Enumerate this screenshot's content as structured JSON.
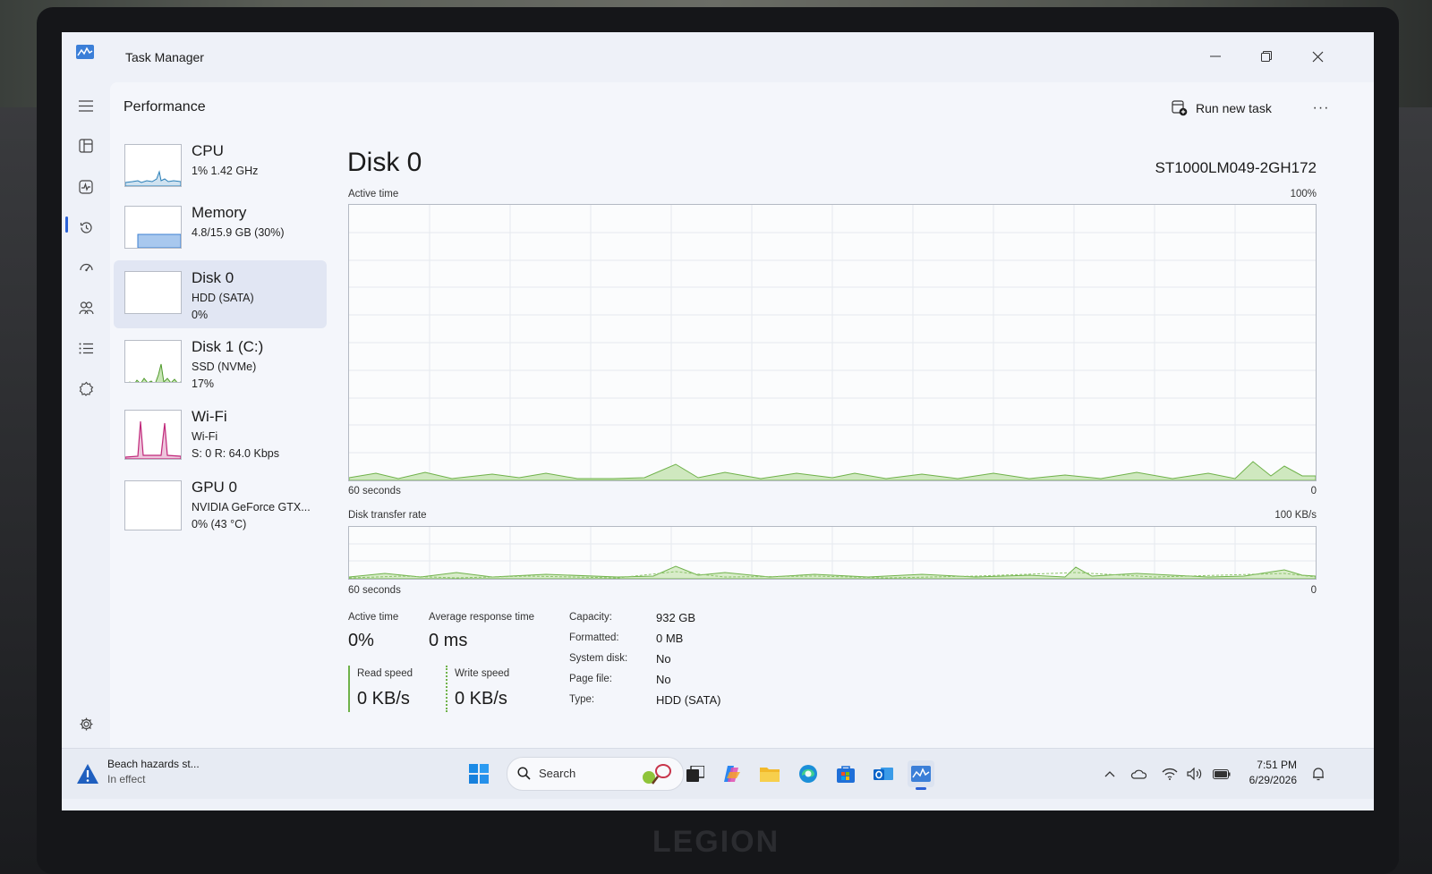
{
  "app": {
    "title": "Task Manager"
  },
  "header": {
    "title": "Performance",
    "run_new_task": "Run new task",
    "more": "···"
  },
  "devices": [
    {
      "name": "CPU",
      "sub": "1% 1.42 GHz",
      "sub2": ""
    },
    {
      "name": "Memory",
      "sub": "4.8/15.9 GB (30%)",
      "sub2": ""
    },
    {
      "name": "Disk 0",
      "sub": "HDD (SATA)",
      "sub2": "0%"
    },
    {
      "name": "Disk 1 (C:)",
      "sub": "SSD (NVMe)",
      "sub2": "17%"
    },
    {
      "name": "Wi-Fi",
      "sub": "Wi-Fi",
      "sub2": "S: 0 R: 64.0 Kbps"
    },
    {
      "name": "GPU 0",
      "sub": "NVIDIA GeForce GTX...",
      "sub2": "0% (43 °C)"
    }
  ],
  "detail": {
    "title": "Disk 0",
    "model": "ST1000LM049-2GH172",
    "active_graph": {
      "label": "Active time",
      "max": "100%",
      "time": "60 seconds",
      "min": "0"
    },
    "transfer_graph": {
      "label": "Disk transfer rate",
      "max": "100 KB/s",
      "time": "60 seconds",
      "min": "0"
    },
    "stats": {
      "active_time_label": "Active time",
      "active_time": "0%",
      "avg_response_label": "Average response time",
      "avg_response": "0 ms",
      "read_label": "Read speed",
      "read": "0 KB/s",
      "write_label": "Write speed",
      "write": "0 KB/s"
    },
    "info": [
      {
        "key": "Capacity:",
        "value": "932 GB"
      },
      {
        "key": "Formatted:",
        "value": "0 MB"
      },
      {
        "key": "System disk:",
        "value": "No"
      },
      {
        "key": "Page file:",
        "value": "No"
      },
      {
        "key": "Type:",
        "value": "HDD (SATA)"
      }
    ]
  },
  "taskbar": {
    "weather_title": "Beach hazards st...",
    "weather_sub": "In effect",
    "search_placeholder": "Search",
    "time": "7:51 PM",
    "date": "6/29/2026"
  },
  "brand": "LEGION",
  "colors": {
    "accent": "#2b62d6",
    "disk_green": "#6fb24a",
    "cpu_blue": "#2a7fb8",
    "wifi_pink": "#c0287a"
  }
}
